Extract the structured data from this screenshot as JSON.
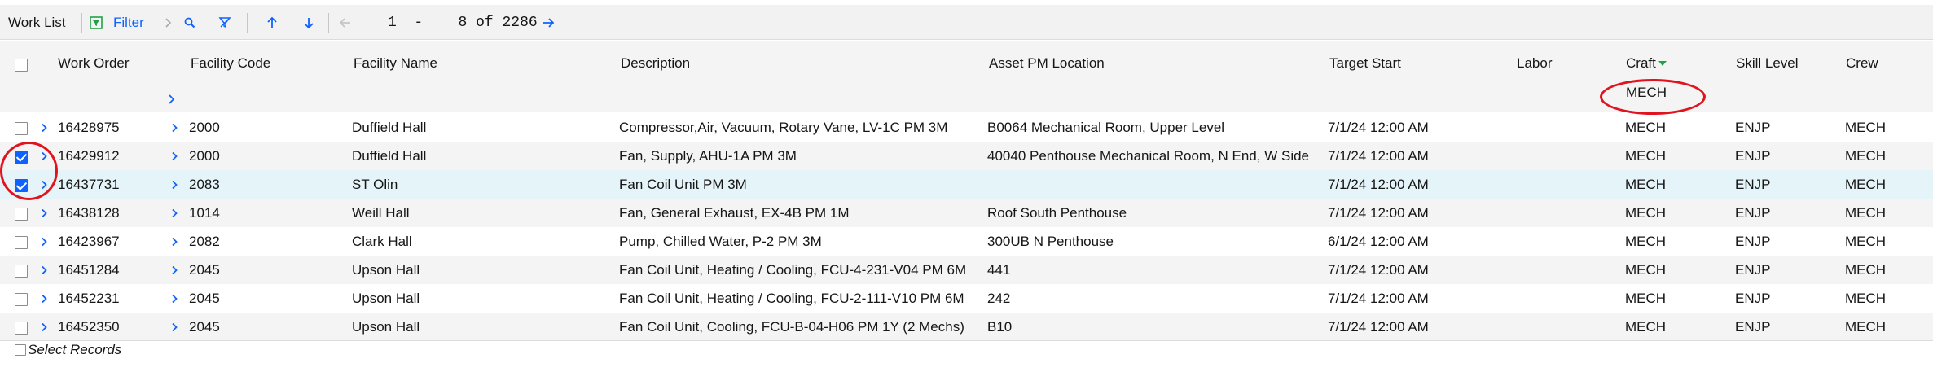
{
  "toolbar": {
    "title": "Work List",
    "filter_label": "Filter",
    "page_start": "1",
    "page_dash": "-",
    "page_end": "8",
    "page_of": "of",
    "total": "2286"
  },
  "columns": {
    "work_order": "Work Order",
    "facility_code": "Facility Code",
    "facility_name": "Facility Name",
    "description": "Description",
    "asset_pm_location": "Asset PM Location",
    "target_start": "Target Start",
    "labor": "Labor",
    "craft": "Craft",
    "skill_level": "Skill Level",
    "crew": "Crew"
  },
  "filters": {
    "craft": "MECH"
  },
  "rows": [
    {
      "checked": false,
      "work_order": "16428975",
      "facility_code": "2000",
      "facility_name": "Duffield Hall",
      "description": "Compressor,Air, Vacuum, Rotary Vane, LV-1C PM 3M",
      "asset_pm_location": "B0064 Mechanical Room, Upper Level",
      "target_start": "7/1/24 12:00 AM",
      "craft": "MECH",
      "skill_level": "ENJP",
      "crew": "MECH"
    },
    {
      "checked": true,
      "work_order": "16429912",
      "facility_code": "2000",
      "facility_name": "Duffield Hall",
      "description": "Fan, Supply, AHU-1A PM 3M",
      "asset_pm_location": "40040 Penthouse Mechanical Room, N End, W Side",
      "target_start": "7/1/24 12:00 AM",
      "craft": "MECH",
      "skill_level": "ENJP",
      "crew": "MECH"
    },
    {
      "checked": true,
      "work_order": "16437731",
      "facility_code": "2083",
      "facility_name": "ST Olin",
      "description": "Fan Coil Unit PM 3M",
      "asset_pm_location": "",
      "target_start": "7/1/24 12:00 AM",
      "craft": "MECH",
      "skill_level": "ENJP",
      "crew": "MECH"
    },
    {
      "checked": false,
      "work_order": "16438128",
      "facility_code": "1014",
      "facility_name": "Weill Hall",
      "description": "Fan, General Exhaust, EX-4B PM 1M",
      "asset_pm_location": "Roof South Penthouse",
      "target_start": "7/1/24 12:00 AM",
      "craft": "MECH",
      "skill_level": "ENJP",
      "crew": "MECH"
    },
    {
      "checked": false,
      "work_order": "16423967",
      "facility_code": "2082",
      "facility_name": "Clark Hall",
      "description": "Pump, Chilled Water, P-2 PM 3M",
      "asset_pm_location": "300UB N Penthouse",
      "target_start": "6/1/24 12:00 AM",
      "craft": "MECH",
      "skill_level": "ENJP",
      "crew": "MECH"
    },
    {
      "checked": false,
      "work_order": "16451284",
      "facility_code": "2045",
      "facility_name": "Upson Hall",
      "description": "Fan Coil Unit, Heating / Cooling, FCU-4-231-V04 PM 6M",
      "asset_pm_location": "441",
      "target_start": "7/1/24 12:00 AM",
      "craft": "MECH",
      "skill_level": "ENJP",
      "crew": "MECH"
    },
    {
      "checked": false,
      "work_order": "16452231",
      "facility_code": "2045",
      "facility_name": "Upson Hall",
      "description": "Fan Coil Unit, Heating / Cooling, FCU-2-111-V10 PM 6M",
      "asset_pm_location": "242",
      "target_start": "7/1/24 12:00 AM",
      "craft": "MECH",
      "skill_level": "ENJP",
      "crew": "MECH"
    },
    {
      "checked": false,
      "work_order": "16452350",
      "facility_code": "2045",
      "facility_name": "Upson Hall",
      "description": "Fan Coil Unit, Cooling, FCU-B-04-H06 PM 1Y (2 Mechs)",
      "asset_pm_location": "B10",
      "target_start": "7/1/24 12:00 AM",
      "craft": "MECH",
      "skill_level": "ENJP",
      "crew": "MECH"
    }
  ],
  "footer": {
    "select_records": "Select Records"
  },
  "icons": {
    "filter": "filter-icon",
    "search": "search-icon",
    "clear_filter": "clear-filter-icon",
    "prev_record": "arrow-up-icon",
    "next_record": "arrow-down-icon",
    "prev_page": "arrow-left-icon",
    "next_page": "arrow-right-icon",
    "sort": "sort-descending-icon"
  },
  "colors": {
    "accent": "#0f62fe",
    "annotation": "#e0141e",
    "selected_row": "#e5f4f9"
  }
}
